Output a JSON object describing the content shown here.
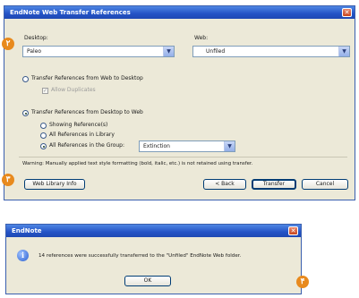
{
  "transfer_dialog": {
    "title": "EndNote Web Transfer References",
    "close_glyph": "✕",
    "desktop_label": "Desktop:",
    "desktop_value": "Paleo",
    "web_label": "Web:",
    "web_value": "Unfiled",
    "option_web_to_desktop": "Transfer References from Web to Desktop",
    "allow_duplicates": "Allow Duplicates",
    "option_desktop_to_web": "Transfer References from Desktop to Web",
    "sub_showing": "Showing Reference(s)",
    "sub_all_in_library": "All References in Library",
    "sub_all_in_group": "All References in the Group:",
    "group_value": "Extinction",
    "warning": "Warning: Manually applied text style formatting (bold, italic, etc.) is not retained using transfer.",
    "web_library_info_button": "Web Library Info",
    "back_button": "< Back",
    "transfer_button": "Transfer",
    "cancel_button": "Cancel"
  },
  "message_box": {
    "title": "EndNote",
    "close_glyph": "✕",
    "message": "14 references were successfully transferred to the \"Unfiled\" EndNote Web folder.",
    "ok_button": "OK"
  },
  "step_markers": {
    "m2": "۲",
    "m3": "۳",
    "m4": "۴"
  },
  "colors": {
    "titlebar": "#2453c6",
    "dialog_bg": "#ece9d8",
    "marker": "#e88a1e"
  },
  "icons": {
    "info": "i",
    "dropdown": "▼"
  }
}
